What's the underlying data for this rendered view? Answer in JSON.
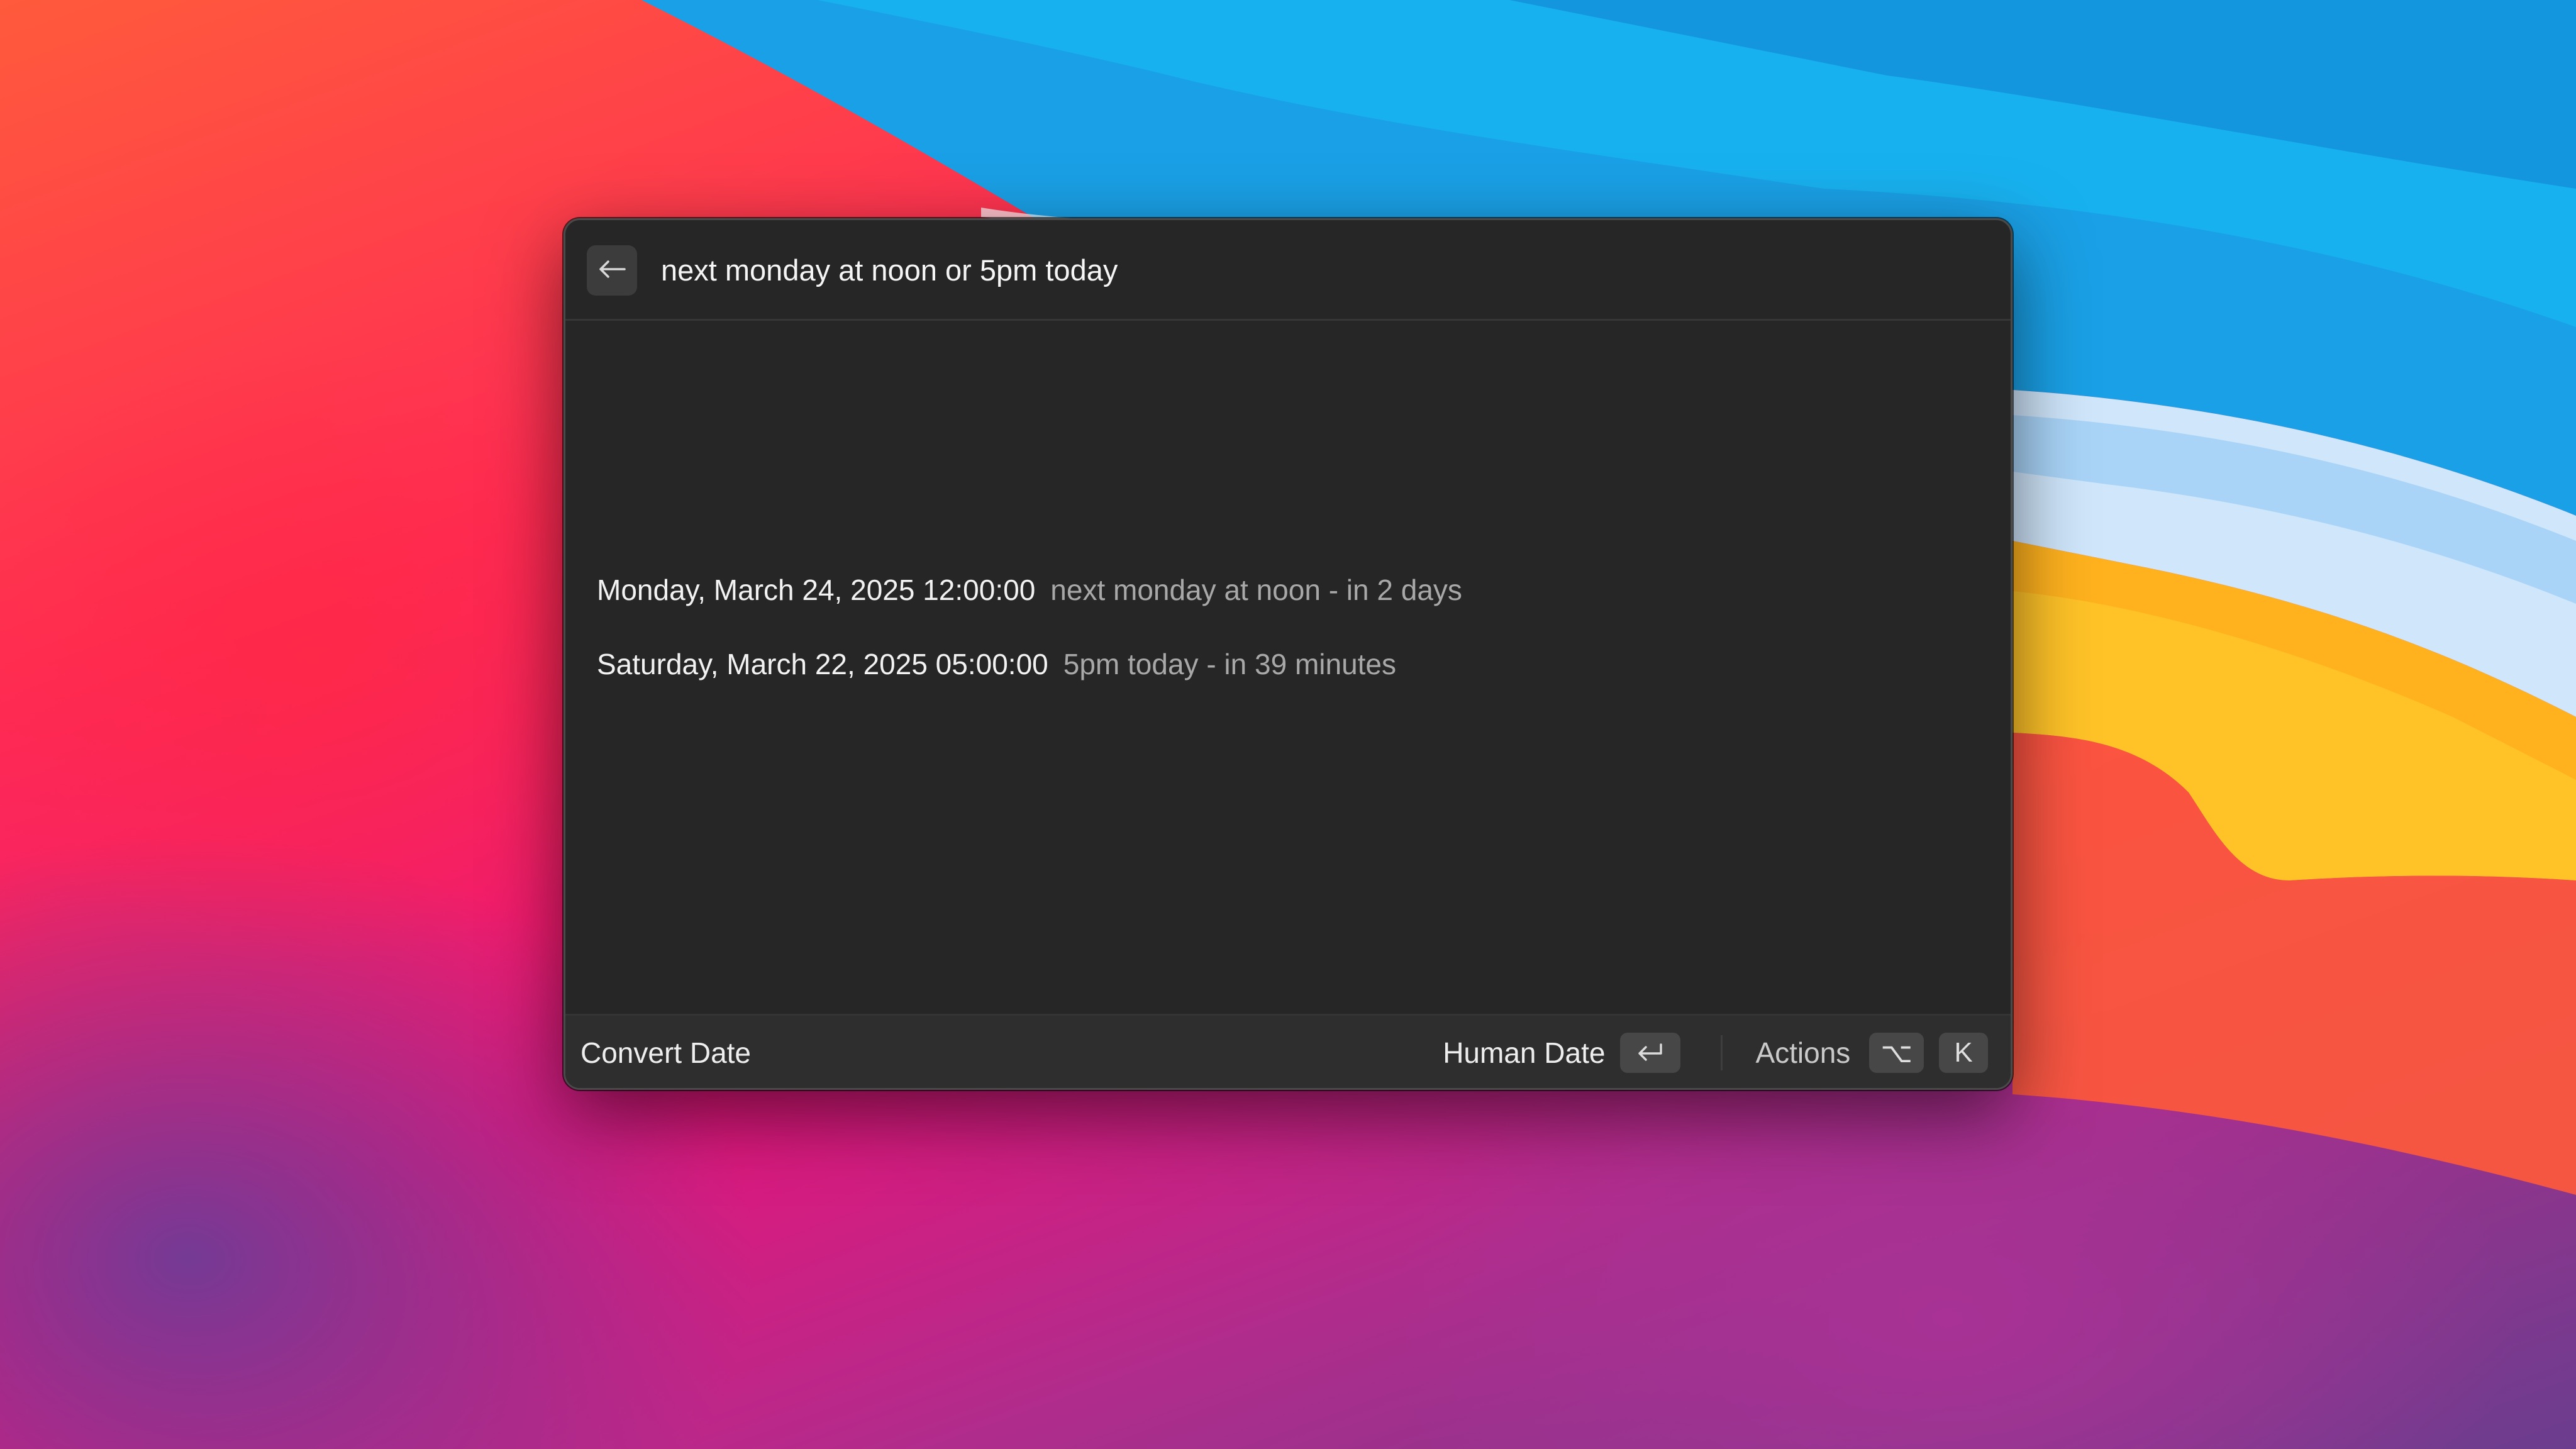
{
  "search": {
    "query": "next monday at noon or 5pm today"
  },
  "results": [
    {
      "title": "Monday, March 24, 2025 12:00:00",
      "subtitle": "next monday at noon - in 2 days"
    },
    {
      "title": "Saturday, March 22, 2025 05:00:00",
      "subtitle": "5pm today - in 39 minutes"
    }
  ],
  "footer": {
    "title": "Convert Date",
    "primary_action": "Human Date",
    "primary_key": "↵",
    "actions_label": "Actions",
    "actions_key_1": "⌥",
    "actions_key_2": "K"
  },
  "icons": {
    "back": "arrow-left-icon",
    "enter": "return-key-icon",
    "option": "option-key-icon"
  },
  "colors": {
    "window_bg": "#262626",
    "footer_bg": "#2e2e2e",
    "text_primary": "#f2f2f2",
    "text_secondary": "#a8a8a8"
  }
}
